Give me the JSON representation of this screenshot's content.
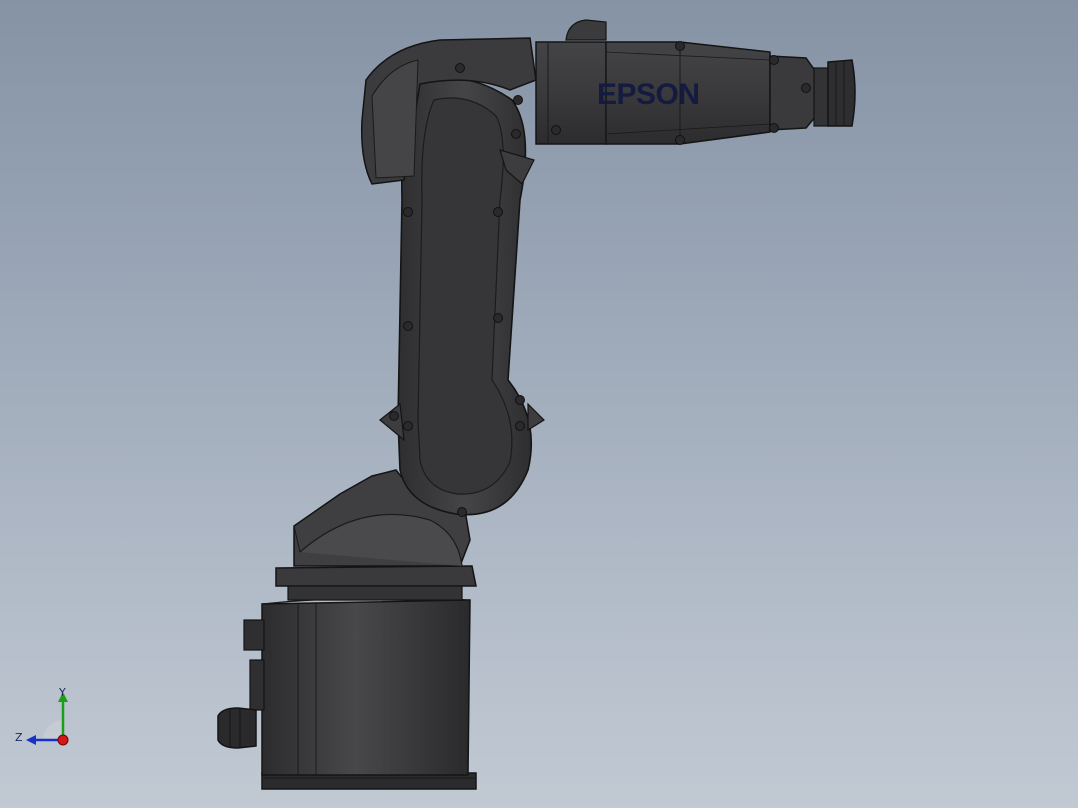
{
  "viewport": {
    "background_top": "#8593a5",
    "background_bottom": "#c1c9d3"
  },
  "model": {
    "brand_label": "EPSON",
    "body_color": "#3c3c3e",
    "edge_color": "#141414",
    "brand_color": "#141a40"
  },
  "triad": {
    "y_label": "Y",
    "z_label": "Z",
    "x_axis_color": "#d01818",
    "y_axis_color": "#18a018",
    "z_axis_color": "#1830c8"
  }
}
